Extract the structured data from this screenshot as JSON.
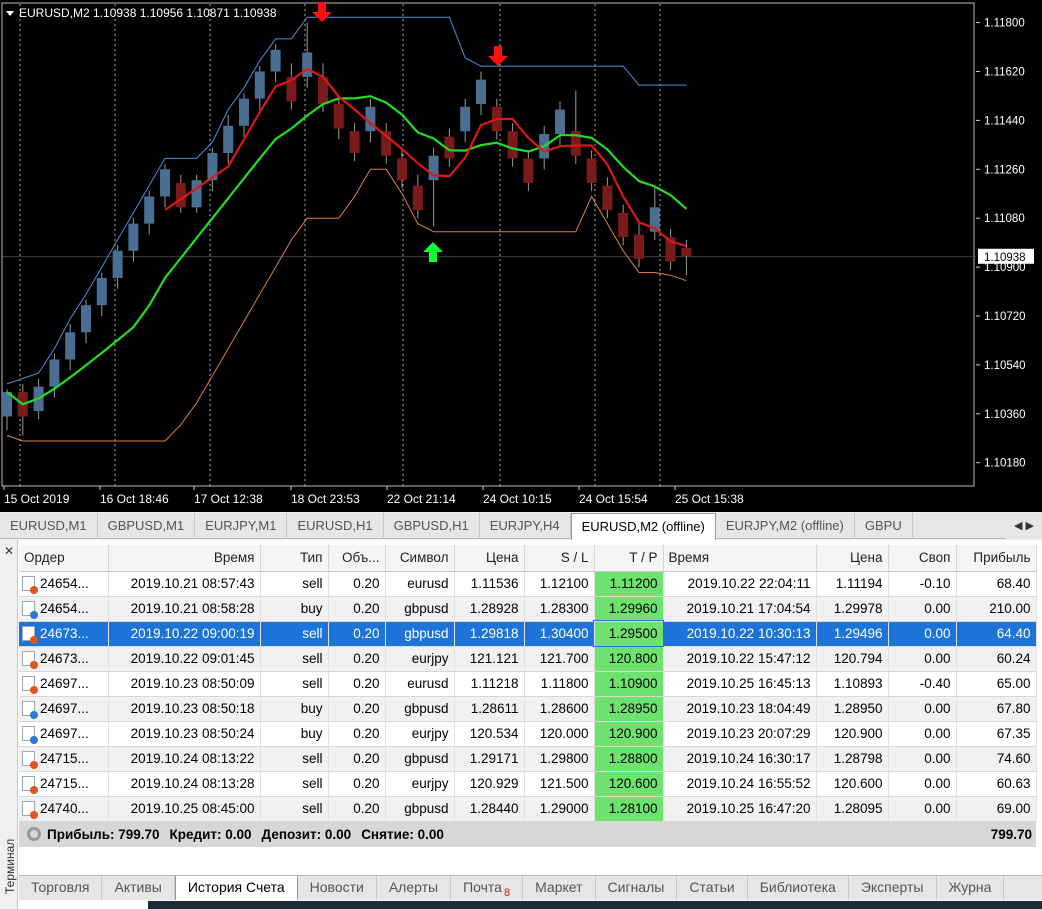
{
  "chart": {
    "title": "EURUSD,M2  1.10938 1.10956 1.10871 1.10938",
    "current_price": "1.10938",
    "price_ticks": [
      "1.11800",
      "1.11620",
      "1.11440",
      "1.11260",
      "1.11080",
      "1.10900",
      "1.10720",
      "1.10540",
      "1.10360",
      "1.10180"
    ],
    "time_labels": [
      "15 Oct 2019",
      "16 Oct 18:46",
      "17 Oct 12:38",
      "18 Oct 23:53",
      "22 Oct 21:14",
      "24 Oct 10:15",
      "24 Oct 15:54",
      "25 Oct 15:38"
    ],
    "colors": {
      "background": "#000000",
      "bull": "#4a6f92",
      "bear": "#7a1a1a",
      "fast_ma": "#e01515",
      "slow_ma": "#22dd22",
      "upper_channel": "#4a90e0",
      "lower_channel": "#e08040",
      "signal_down": "#ff1010",
      "signal_up": "#10ff30"
    }
  },
  "chart_data": {
    "type": "candlestick",
    "ylim": [
      1.1012,
      1.1185
    ],
    "candles": [
      [
        1.1035,
        1.1044,
        1.103,
        1.1045
      ],
      [
        1.1044,
        1.1035,
        1.1028,
        1.1047
      ],
      [
        1.1037,
        1.1046,
        1.1034,
        1.1049
      ],
      [
        1.1046,
        1.1056,
        1.1042,
        1.1058
      ],
      [
        1.1056,
        1.1066,
        1.1052,
        1.1069
      ],
      [
        1.1066,
        1.1076,
        1.1062,
        1.1078
      ],
      [
        1.1076,
        1.1086,
        1.1072,
        1.1088
      ],
      [
        1.1086,
        1.1096,
        1.1082,
        1.1098
      ],
      [
        1.1096,
        1.1106,
        1.1092,
        1.1108
      ],
      [
        1.1106,
        1.1116,
        1.1102,
        1.1118
      ],
      [
        1.1116,
        1.1126,
        1.1112,
        1.1128
      ],
      [
        1.1121,
        1.1112,
        1.111,
        1.1124
      ],
      [
        1.1112,
        1.1122,
        1.111,
        1.1124
      ],
      [
        1.1122,
        1.1132,
        1.1118,
        1.1134
      ],
      [
        1.1132,
        1.1142,
        1.1128,
        1.1146
      ],
      [
        1.1142,
        1.1152,
        1.1138,
        1.1154
      ],
      [
        1.1152,
        1.1162,
        1.1148,
        1.1164
      ],
      [
        1.1162,
        1.117,
        1.1158,
        1.1172
      ],
      [
        1.116,
        1.1151,
        1.1148,
        1.1165
      ],
      [
        1.116,
        1.1169,
        1.1156,
        1.118
      ],
      [
        1.116,
        1.115,
        1.1147,
        1.1165
      ],
      [
        1.115,
        1.1141,
        1.1137,
        1.1153
      ],
      [
        1.114,
        1.1132,
        1.1129,
        1.1143
      ],
      [
        1.114,
        1.1149,
        1.1136,
        1.1152
      ],
      [
        1.114,
        1.1131,
        1.1128,
        1.1143
      ],
      [
        1.113,
        1.1122,
        1.1119,
        1.1133
      ],
      [
        1.112,
        1.1111,
        1.1108,
        1.1124
      ],
      [
        1.1122,
        1.1131,
        1.1105,
        1.1134
      ],
      [
        1.1138,
        1.113,
        1.1127,
        1.1141
      ],
      [
        1.114,
        1.1149,
        1.1136,
        1.1152
      ],
      [
        1.115,
        1.1159,
        1.1146,
        1.1162
      ],
      [
        1.1149,
        1.114,
        1.1137,
        1.1152
      ],
      [
        1.114,
        1.113,
        1.1127,
        1.1143
      ],
      [
        1.113,
        1.1121,
        1.1118,
        1.1133
      ],
      [
        1.113,
        1.1139,
        1.1126,
        1.1142
      ],
      [
        1.1139,
        1.1148,
        1.1135,
        1.1151
      ],
      [
        1.114,
        1.1131,
        1.1128,
        1.1155
      ],
      [
        1.113,
        1.1121,
        1.1118,
        1.1133
      ],
      [
        1.112,
        1.1111,
        1.1108,
        1.1123
      ],
      [
        1.111,
        1.1101,
        1.1098,
        1.1113
      ],
      [
        1.1102,
        1.1093,
        1.109,
        1.1106
      ],
      [
        1.1103,
        1.1112,
        1.11,
        1.112
      ],
      [
        1.1101,
        1.1092,
        1.1089,
        1.1104
      ],
      [
        1.1097,
        1.1094,
        1.1087,
        1.11
      ]
    ]
  },
  "symbol_tabs": [
    {
      "label": "EURUSD,M1"
    },
    {
      "label": "GBPUSD,M1"
    },
    {
      "label": "EURJPY,M1"
    },
    {
      "label": "EURUSD,H1"
    },
    {
      "label": "GBPUSD,H1"
    },
    {
      "label": "EURJPY,H4"
    },
    {
      "label": "EURUSD,M2 (offline)",
      "active": true
    },
    {
      "label": "EURJPY,M2 (offline)"
    },
    {
      "label": "GBPU"
    }
  ],
  "terminal": {
    "side_label": "Терминал",
    "columns": [
      "Ордер",
      "Время",
      "Тип",
      "Объ...",
      "Символ",
      "Цена",
      "S / L",
      "T / P",
      "Время",
      "Цена",
      "Своп",
      "Прибыль"
    ],
    "rows": [
      [
        "24654...",
        "2019.10.21 08:57:43",
        "sell",
        "0.20",
        "eurusd",
        "1.11536",
        "1.12100",
        "1.11200",
        "2019.10.22 22:04:11",
        "1.11194",
        "-0.10",
        "68.40"
      ],
      [
        "24654...",
        "2019.10.21 08:58:28",
        "buy",
        "0.20",
        "gbpusd",
        "1.28928",
        "1.28300",
        "1.29960",
        "2019.10.21 17:04:54",
        "1.29978",
        "0.00",
        "210.00"
      ],
      [
        "24673...",
        "2019.10.22 09:00:19",
        "sell",
        "0.20",
        "gbpusd",
        "1.29818",
        "1.30400",
        "1.29500",
        "2019.10.22 10:30:13",
        "1.29496",
        "0.00",
        "64.40"
      ],
      [
        "24673...",
        "2019.10.22 09:01:45",
        "sell",
        "0.20",
        "eurjpy",
        "121.121",
        "121.700",
        "120.800",
        "2019.10.22 15:47:12",
        "120.794",
        "0.00",
        "60.24"
      ],
      [
        "24697...",
        "2019.10.23 08:50:09",
        "sell",
        "0.20",
        "eurusd",
        "1.11218",
        "1.11800",
        "1.10900",
        "2019.10.25 16:45:13",
        "1.10893",
        "-0.40",
        "65.00"
      ],
      [
        "24697...",
        "2019.10.23 08:50:18",
        "buy",
        "0.20",
        "gbpusd",
        "1.28611",
        "1.28600",
        "1.28950",
        "2019.10.23 18:04:49",
        "1.28950",
        "0.00",
        "67.80"
      ],
      [
        "24697...",
        "2019.10.23 08:50:24",
        "buy",
        "0.20",
        "eurjpy",
        "120.534",
        "120.000",
        "120.900",
        "2019.10.23 20:07:29",
        "120.900",
        "0.00",
        "67.35"
      ],
      [
        "24715...",
        "2019.10.24 08:13:22",
        "sell",
        "0.20",
        "gbpusd",
        "1.29171",
        "1.29800",
        "1.28800",
        "2019.10.24 16:30:17",
        "1.28798",
        "0.00",
        "74.60"
      ],
      [
        "24715...",
        "2019.10.24 08:13:28",
        "sell",
        "0.20",
        "eurjpy",
        "120.929",
        "121.500",
        "120.600",
        "2019.10.24 16:55:52",
        "120.600",
        "0.00",
        "60.63"
      ],
      [
        "24740...",
        "2019.10.25 08:45:00",
        "sell",
        "0.20",
        "gbpusd",
        "1.28440",
        "1.29000",
        "1.28100",
        "2019.10.25 16:47:20",
        "1.28095",
        "0.00",
        "69.00"
      ]
    ],
    "selected_row": 2,
    "summary": {
      "profit": "Прибыль: 799.70",
      "credit": "Кредит: 0.00",
      "deposit": "Депозит: 0.00",
      "withdraw": "Снятие: 0.00",
      "total": "799.70"
    },
    "tabs": [
      {
        "label": "Торговля"
      },
      {
        "label": "Активы"
      },
      {
        "label": "История Счета",
        "active": true
      },
      {
        "label": "Новости"
      },
      {
        "label": "Алерты"
      },
      {
        "label": "Почта",
        "badge": "8"
      },
      {
        "label": "Маркет"
      },
      {
        "label": "Сигналы"
      },
      {
        "label": "Статьи"
      },
      {
        "label": "Библиотека"
      },
      {
        "label": "Эксперты"
      },
      {
        "label": "Журна"
      }
    ]
  }
}
